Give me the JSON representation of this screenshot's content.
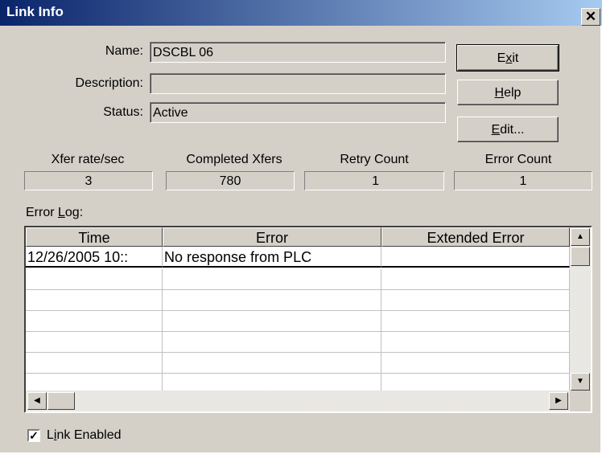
{
  "window": {
    "title": "Link Info",
    "close_glyph": "✕"
  },
  "fields": {
    "name_label": "Name:",
    "name_value": "DSCBL 06",
    "description_label": "Description:",
    "description_value": "",
    "status_label": "Status:",
    "status_value": "Active"
  },
  "buttons": {
    "exit_pre": "E",
    "exit_u": "x",
    "exit_post": "it",
    "help_u": "H",
    "help_post": "elp",
    "edit_u": "E",
    "edit_post": "dit..."
  },
  "stats": [
    {
      "label": "Xfer rate/sec",
      "value": "3"
    },
    {
      "label": "Completed Xfers",
      "value": "780"
    },
    {
      "label": "Retry Count",
      "value": "1"
    },
    {
      "label": "Error Count",
      "value": "1"
    }
  ],
  "error_log": {
    "label_pre": "Error ",
    "label_u": "L",
    "label_post": "og:",
    "columns": [
      "Time",
      "Error",
      "Extended Error"
    ],
    "rows": [
      [
        "12/26/2005 10::",
        "No response from PLC",
        ""
      ]
    ]
  },
  "checkbox": {
    "label_pre": "L",
    "label_u": "i",
    "label_post": "nk Enabled",
    "checked": true,
    "mark": "✓"
  },
  "icons": {
    "scroll_up": "▲",
    "scroll_down": "▼",
    "scroll_left": "◀",
    "scroll_right": "▶"
  }
}
